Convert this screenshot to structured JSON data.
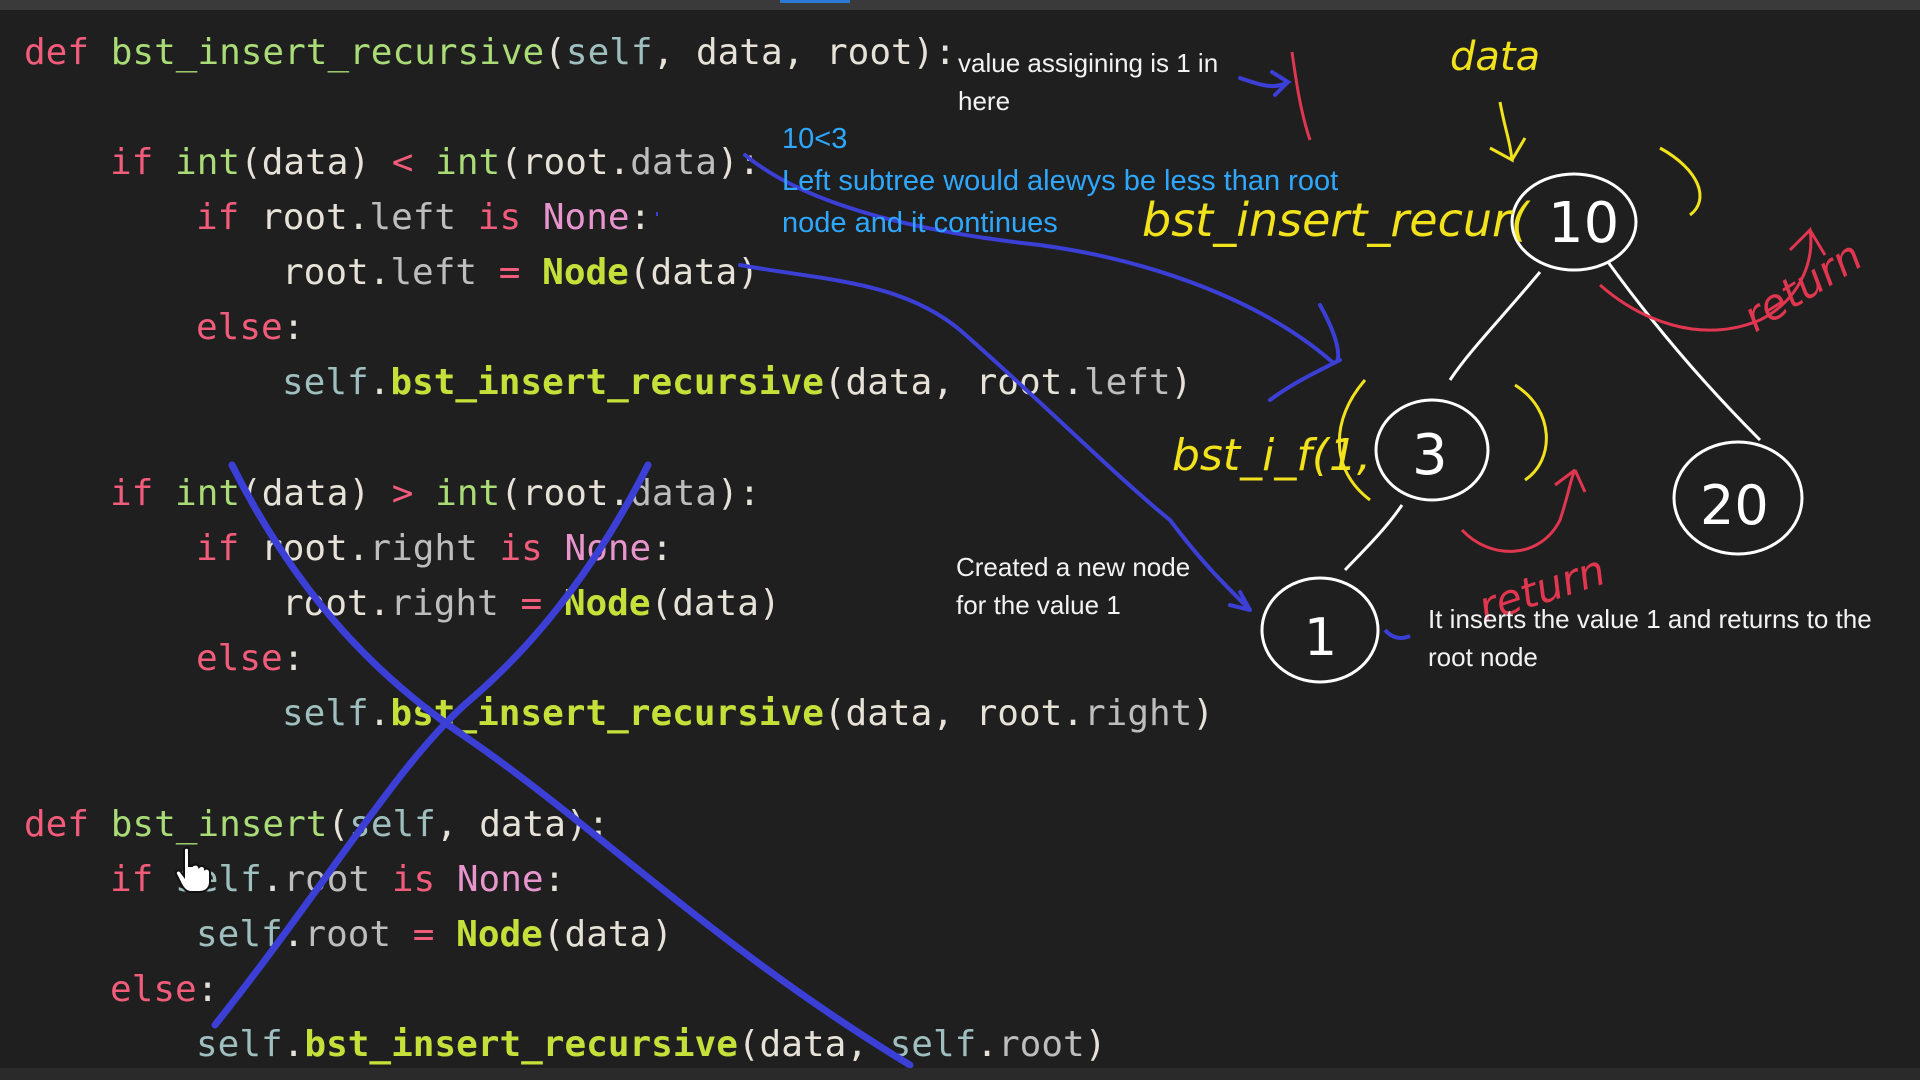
{
  "code": {
    "lines": [
      {
        "id": "l1",
        "indent": 0,
        "tokens": [
          [
            "kw",
            "def"
          ],
          [
            "txt",
            " "
          ],
          [
            "fn",
            "bst_insert_recursive"
          ],
          [
            "txt",
            "("
          ],
          [
            "self",
            "self"
          ],
          [
            "txt",
            ", data, root):"
          ]
        ]
      },
      {
        "id": "l2",
        "indent": 4,
        "tokens": [
          [
            "kw",
            "if"
          ],
          [
            "txt",
            " "
          ],
          [
            "bi",
            "int"
          ],
          [
            "txt",
            "(data) "
          ],
          [
            "kw",
            "<"
          ],
          [
            "txt",
            " "
          ],
          [
            "bi",
            "int"
          ],
          [
            "txt",
            "(root."
          ],
          [
            "dim",
            "data"
          ],
          [
            "txt",
            "):"
          ]
        ]
      },
      {
        "id": "l3",
        "indent": 8,
        "tokens": [
          [
            "kw",
            "if"
          ],
          [
            "txt",
            " root."
          ],
          [
            "dim",
            "left"
          ],
          [
            "txt",
            " "
          ],
          [
            "kw",
            "is"
          ],
          [
            "txt",
            " "
          ],
          [
            "none",
            "None"
          ],
          [
            "txt",
            ":"
          ]
        ]
      },
      {
        "id": "l4",
        "indent": 12,
        "tokens": [
          [
            "txt",
            "root."
          ],
          [
            "dim",
            "left"
          ],
          [
            "txt",
            " "
          ],
          [
            "kw",
            "="
          ],
          [
            "txt",
            " "
          ],
          [
            "hl",
            "Node"
          ],
          [
            "txt",
            "(data)"
          ]
        ]
      },
      {
        "id": "l5",
        "indent": 8,
        "tokens": [
          [
            "kw",
            "else"
          ],
          [
            "txt",
            ":"
          ]
        ]
      },
      {
        "id": "l6",
        "indent": 12,
        "tokens": [
          [
            "self",
            "self"
          ],
          [
            "txt",
            "."
          ],
          [
            "hl",
            "bst_insert_recursive"
          ],
          [
            "txt",
            "(data, root."
          ],
          [
            "dim",
            "left"
          ],
          [
            "txt",
            ")"
          ]
        ]
      },
      {
        "id": "l7",
        "indent": 4,
        "tokens": [
          [
            "kw",
            "if"
          ],
          [
            "txt",
            " "
          ],
          [
            "bi",
            "int"
          ],
          [
            "txt",
            "(data) "
          ],
          [
            "kw",
            ">"
          ],
          [
            "txt",
            " "
          ],
          [
            "bi",
            "int"
          ],
          [
            "txt",
            "(root."
          ],
          [
            "dim",
            "data"
          ],
          [
            "txt",
            "):"
          ]
        ]
      },
      {
        "id": "l8",
        "indent": 8,
        "tokens": [
          [
            "kw",
            "if"
          ],
          [
            "txt",
            " root."
          ],
          [
            "dim",
            "right"
          ],
          [
            "txt",
            " "
          ],
          [
            "kw",
            "is"
          ],
          [
            "txt",
            " "
          ],
          [
            "none",
            "None"
          ],
          [
            "txt",
            ":"
          ]
        ]
      },
      {
        "id": "l9",
        "indent": 12,
        "tokens": [
          [
            "txt",
            "root."
          ],
          [
            "dim",
            "right"
          ],
          [
            "txt",
            " "
          ],
          [
            "kw",
            "="
          ],
          [
            "txt",
            " "
          ],
          [
            "hl",
            "Node"
          ],
          [
            "txt",
            "(data)"
          ]
        ]
      },
      {
        "id": "l10",
        "indent": 8,
        "tokens": [
          [
            "kw",
            "else"
          ],
          [
            "txt",
            ":"
          ]
        ]
      },
      {
        "id": "l11",
        "indent": 12,
        "tokens": [
          [
            "self",
            "self"
          ],
          [
            "txt",
            "."
          ],
          [
            "hl",
            "bst_insert_recursive"
          ],
          [
            "txt",
            "(data, root."
          ],
          [
            "dim",
            "right"
          ],
          [
            "txt",
            ")"
          ]
        ]
      },
      {
        "id": "l12",
        "indent": 0,
        "tokens": [
          [
            "kw",
            "def"
          ],
          [
            "txt",
            " "
          ],
          [
            "fn",
            "bst_insert"
          ],
          [
            "txt",
            "("
          ],
          [
            "self",
            "self"
          ],
          [
            "txt",
            ", data):"
          ]
        ]
      },
      {
        "id": "l13",
        "indent": 4,
        "tokens": [
          [
            "kw",
            "if"
          ],
          [
            "txt",
            " "
          ],
          [
            "self",
            "self"
          ],
          [
            "txt",
            "."
          ],
          [
            "dim",
            "root"
          ],
          [
            "txt",
            " "
          ],
          [
            "kw",
            "is"
          ],
          [
            "txt",
            " "
          ],
          [
            "none",
            "None"
          ],
          [
            "txt",
            ":"
          ]
        ]
      },
      {
        "id": "l14",
        "indent": 8,
        "tokens": [
          [
            "self",
            "self"
          ],
          [
            "txt",
            "."
          ],
          [
            "dim",
            "root"
          ],
          [
            "txt",
            " "
          ],
          [
            "kw",
            "="
          ],
          [
            "txt",
            " "
          ],
          [
            "hl",
            "Node"
          ],
          [
            "txt",
            "(data)"
          ]
        ]
      },
      {
        "id": "l15",
        "indent": 4,
        "tokens": [
          [
            "kw",
            "else"
          ],
          [
            "txt",
            ":"
          ]
        ]
      },
      {
        "id": "l16",
        "indent": 8,
        "tokens": [
          [
            "self",
            "self"
          ],
          [
            "txt",
            "."
          ],
          [
            "hl",
            "bst_insert_recursive"
          ],
          [
            "txt",
            "(data, "
          ],
          [
            "self",
            "self"
          ],
          [
            "txt",
            "."
          ],
          [
            "dim",
            "root"
          ],
          [
            "txt",
            ")"
          ]
        ]
      }
    ]
  },
  "notes": {
    "value_assigning": "value assigining is 1 in\nhere",
    "compare": "10<3",
    "left_subtree": "Left subtree would alewys be less than root\nnode and it continues",
    "created_node": "Created a new node\nfor the value 1",
    "inserts_value": "It inserts the value 1 and returns to the\nroot node"
  },
  "handwriting": {
    "data_label": "data",
    "call_root": "bst_insert_recur(",
    "call_child": "bst_i_f(1,",
    "return_right": "return",
    "return_bottom": "return",
    "node_values": [
      "10",
      "3",
      "20",
      "1"
    ],
    "digit_one": "1"
  },
  "colors": {
    "background": "#1f1f1f",
    "pen_blue": "#3b3fd6",
    "pen_yellow": "#f2e21c",
    "pen_red": "#e0364f",
    "pen_white": "#ffffff",
    "note_blue": "#2ea8ff"
  },
  "icons": {
    "mouse_cursor": "hand-pointer-icon"
  }
}
